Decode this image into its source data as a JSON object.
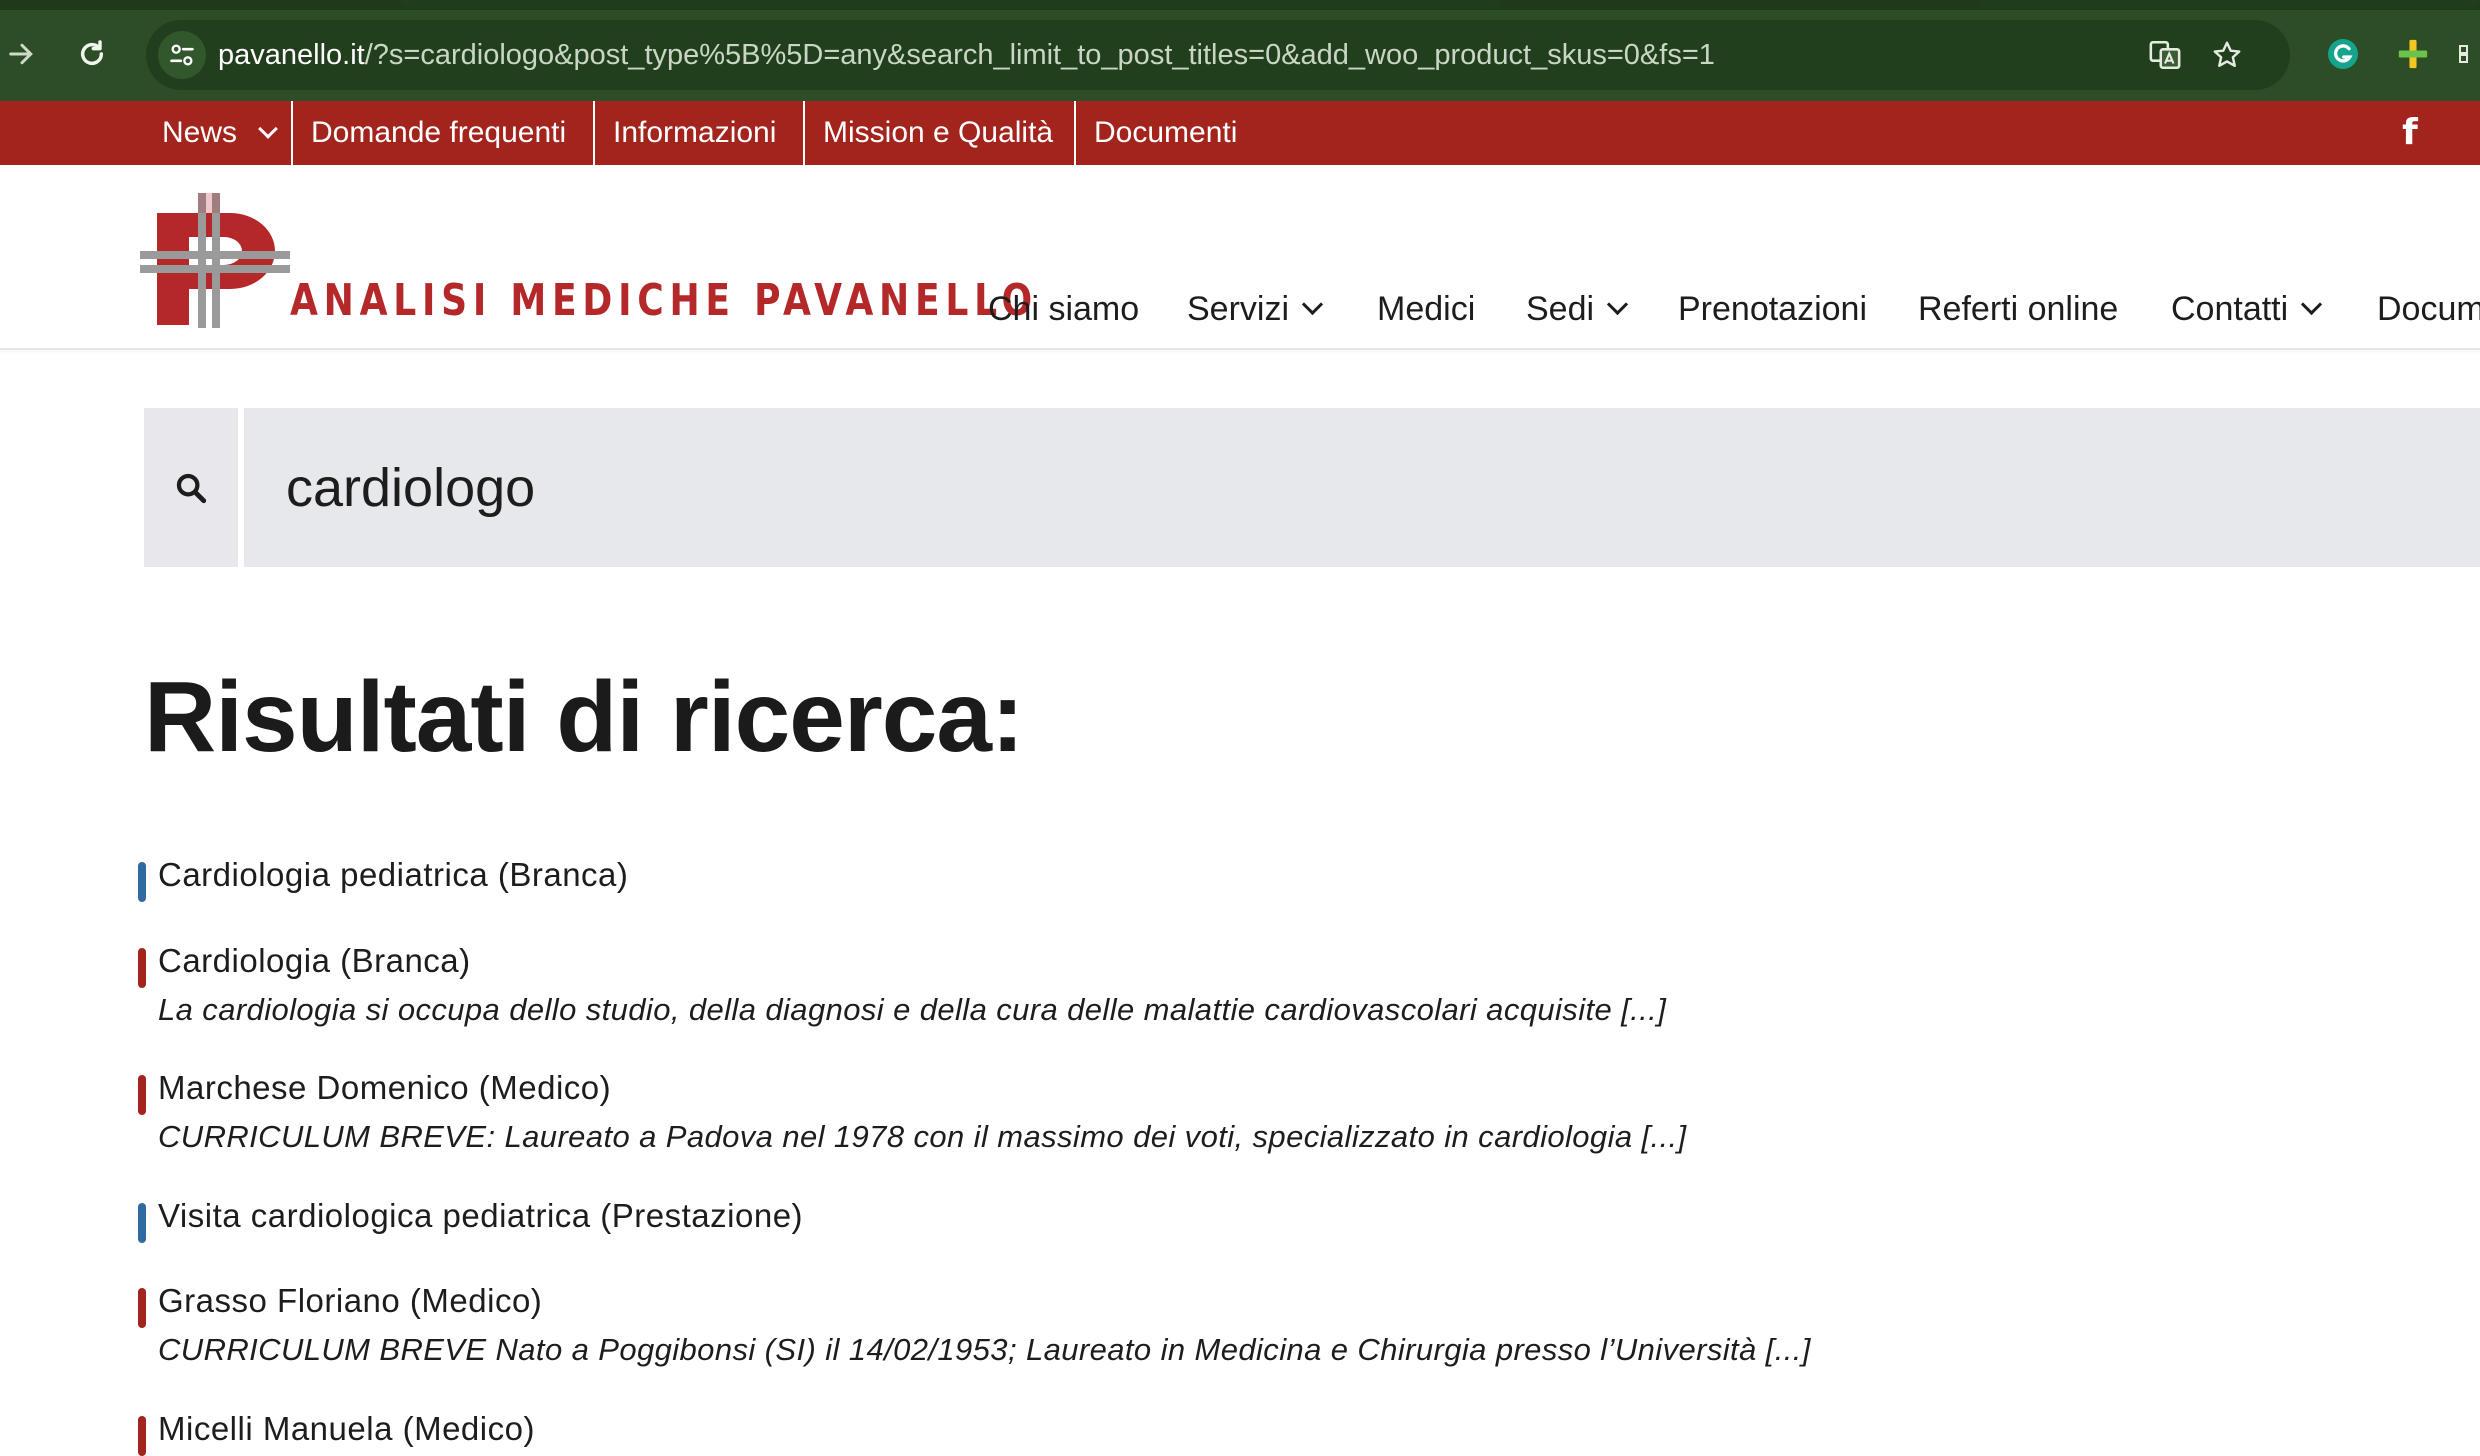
{
  "browser": {
    "url_host": "pavanello.it",
    "url_rest": "/?s=cardiologo&post_type%5B%5D=any&search_limit_to_post_titles=0&add_woo_product_skus=0&fs=1"
  },
  "topbar": {
    "items": [
      {
        "label": "News"
      },
      {
        "label": "Domande frequenti"
      },
      {
        "label": "Informazioni"
      },
      {
        "label": "Mission e Qualità"
      },
      {
        "label": "Documenti"
      }
    ],
    "facebook_glyph": "f"
  },
  "header": {
    "brand": "ANALISI MEDICHE PAVANELLO",
    "nav": [
      {
        "label": "Chi siamo"
      },
      {
        "label": "Servizi"
      },
      {
        "label": "Medici"
      },
      {
        "label": "Sedi"
      },
      {
        "label": "Prenotazioni"
      },
      {
        "label": "Referti online"
      },
      {
        "label": "Contatti"
      },
      {
        "label": "Docum"
      }
    ]
  },
  "search": {
    "query": "cardiologo"
  },
  "results": {
    "heading": "Risultati di ricerca:",
    "items": [
      {
        "title": "Cardiologia pediatrica (Branca)",
        "excerpt": "",
        "color": "#2f6aa0"
      },
      {
        "title": "Cardiologia (Branca)",
        "excerpt": "La cardiologia si occupa dello studio, della diagnosi e della cura delle malattie cardiovascolari acquisite [...]",
        "color": "#a3231d"
      },
      {
        "title": "Marchese Domenico (Medico)",
        "excerpt": "CURRICULUM BREVE: Laureato a Padova nel 1978 con il massimo dei voti, specializzato in cardiologia [...]",
        "color": "#a3231d"
      },
      {
        "title": "Visita cardiologica pediatrica (Prestazione)",
        "excerpt": "",
        "color": "#2f6aa0"
      },
      {
        "title": "Grasso Floriano (Medico)",
        "excerpt": "CURRICULUM BREVE Nato a Poggibonsi (SI) il 14/02/1953; Laureato in Medicina e Chirurgia presso l’Università [...]",
        "color": "#a3231d"
      },
      {
        "title": "Micelli Manuela (Medico)",
        "excerpt": "",
        "color": "#a3231d"
      }
    ]
  },
  "colors": {
    "chrome_bg": "#2c4d25",
    "topbar_bg": "#a3231d",
    "brand_red": "#b4282a",
    "search_bg": "#e7e8ec",
    "branca_blue": "#2f6aa0"
  },
  "icons": [
    "forward-icon",
    "reload-icon",
    "site-info-icon",
    "translate-icon",
    "bookmark-star-icon",
    "grammarly-icon",
    "extension-plus-icon",
    "chevron-down-icon",
    "facebook-icon",
    "search-icon"
  ]
}
